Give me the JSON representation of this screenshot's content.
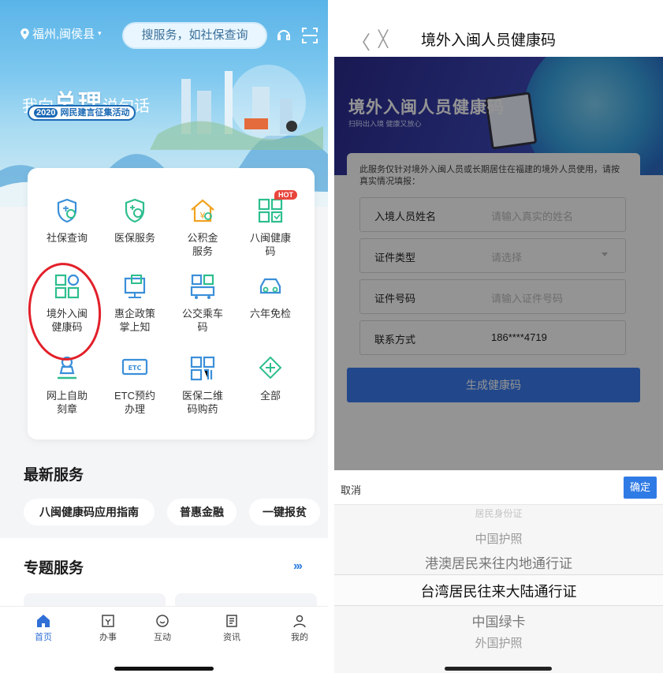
{
  "left": {
    "location": "福州,闽侯县",
    "search_placeholder": "搜服务，如社保查询",
    "banner": {
      "slogan_pre1": "我向",
      "slogan_big": "总理",
      "slogan_pre2": "说句话",
      "badge_year": "2020",
      "badge_text": "网民建言征集活动"
    },
    "grid": [
      {
        "label": "社保查询",
        "icon": "social-security-shield-icon"
      },
      {
        "label": "医保服务",
        "icon": "medical-shield-icon"
      },
      {
        "label": "公积金\n服务",
        "icon": "housing-fund-icon"
      },
      {
        "label": "八闽健康\n码",
        "icon": "health-qr-icon",
        "hot": "HOT"
      },
      {
        "label": "境外入闽\n健康码",
        "icon": "overseas-health-qr-icon"
      },
      {
        "label": "惠企政策\n掌上知",
        "icon": "policy-doc-icon"
      },
      {
        "label": "公交乘车\n码",
        "icon": "bus-qr-icon"
      },
      {
        "label": "六年免检",
        "icon": "car-inspection-icon"
      },
      {
        "label": "网上自助\n刻章",
        "icon": "seal-icon"
      },
      {
        "label": "ETC预约\n办理",
        "icon": "etc-icon",
        "etc_text": "ETC"
      },
      {
        "label": "医保二维\n码购药",
        "icon": "medical-qr-icon"
      },
      {
        "label": "全部",
        "icon": "all-services-icon"
      }
    ],
    "latest_title": "最新服务",
    "chips": [
      "八闽健康码应用指南",
      "普惠金融",
      "一键报贫"
    ],
    "topic_title": "专题服务",
    "more": "›››",
    "tabs": [
      {
        "label": "首页",
        "icon": "home-icon",
        "active": true
      },
      {
        "label": "办事",
        "icon": "service-icon"
      },
      {
        "label": "互动",
        "icon": "interact-icon"
      },
      {
        "label": "资讯",
        "icon": "news-icon"
      },
      {
        "label": "我的",
        "icon": "profile-icon"
      }
    ]
  },
  "right": {
    "nav_title": "境外入闽人员健康码",
    "back": "〈",
    "close": "╳",
    "hero_title": "境外入闽人员健康码",
    "hero_sub": "扫码出入境 健康又放心",
    "notice": "此服务仅针对境外入闽人员或长期居住在福建的境外人员使用，请按真实情况填报：",
    "fields": [
      {
        "key": "入境人员姓名",
        "placeholder": "请输入真实的姓名"
      },
      {
        "key": "证件类型",
        "placeholder": "请选择"
      },
      {
        "key": "证件号码",
        "placeholder": "请输入证件号码"
      },
      {
        "key": "联系方式",
        "value": "186****4719"
      }
    ],
    "submit": "生成健康码",
    "sheet": {
      "cancel": "取消",
      "confirm": "确定",
      "options": [
        "居民身份证",
        "中国护照",
        "港澳居民来往内地通行证",
        "台湾居民往来大陆通行证",
        "中国绿卡",
        "外国护照"
      ],
      "selected_index": 3
    }
  }
}
